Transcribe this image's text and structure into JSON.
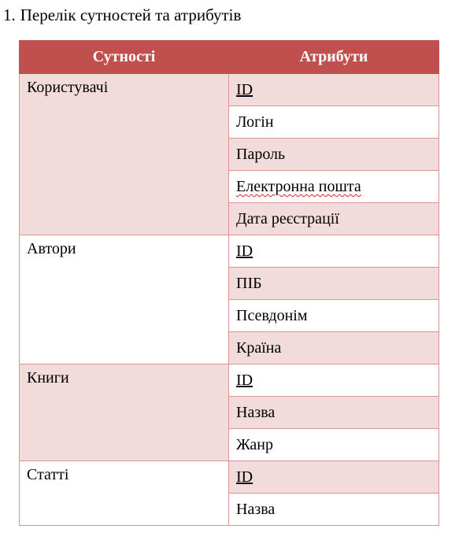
{
  "heading": {
    "number": "1.",
    "text": "Перелік сутностей та атрибутів"
  },
  "table": {
    "headers": [
      "Сутності",
      "Атрибути"
    ],
    "entities": [
      {
        "name": "Користувачі",
        "attributes": [
          "ID",
          "Логін",
          "Пароль",
          "Електронна пошта",
          "Дата реєстрації"
        ]
      },
      {
        "name": "Автори",
        "attributes": [
          "ID",
          "ПІБ",
          "Псевдонім",
          "Країна"
        ]
      },
      {
        "name": "Книги",
        "attributes": [
          "ID",
          "Назва",
          "Жанр"
        ]
      },
      {
        "name": "Статті",
        "attributes": [
          "ID",
          "Назва"
        ]
      }
    ]
  },
  "colors": {
    "header_bg": "#c0504d",
    "band_bg": "#f2dbdb",
    "border": "#d99594"
  }
}
